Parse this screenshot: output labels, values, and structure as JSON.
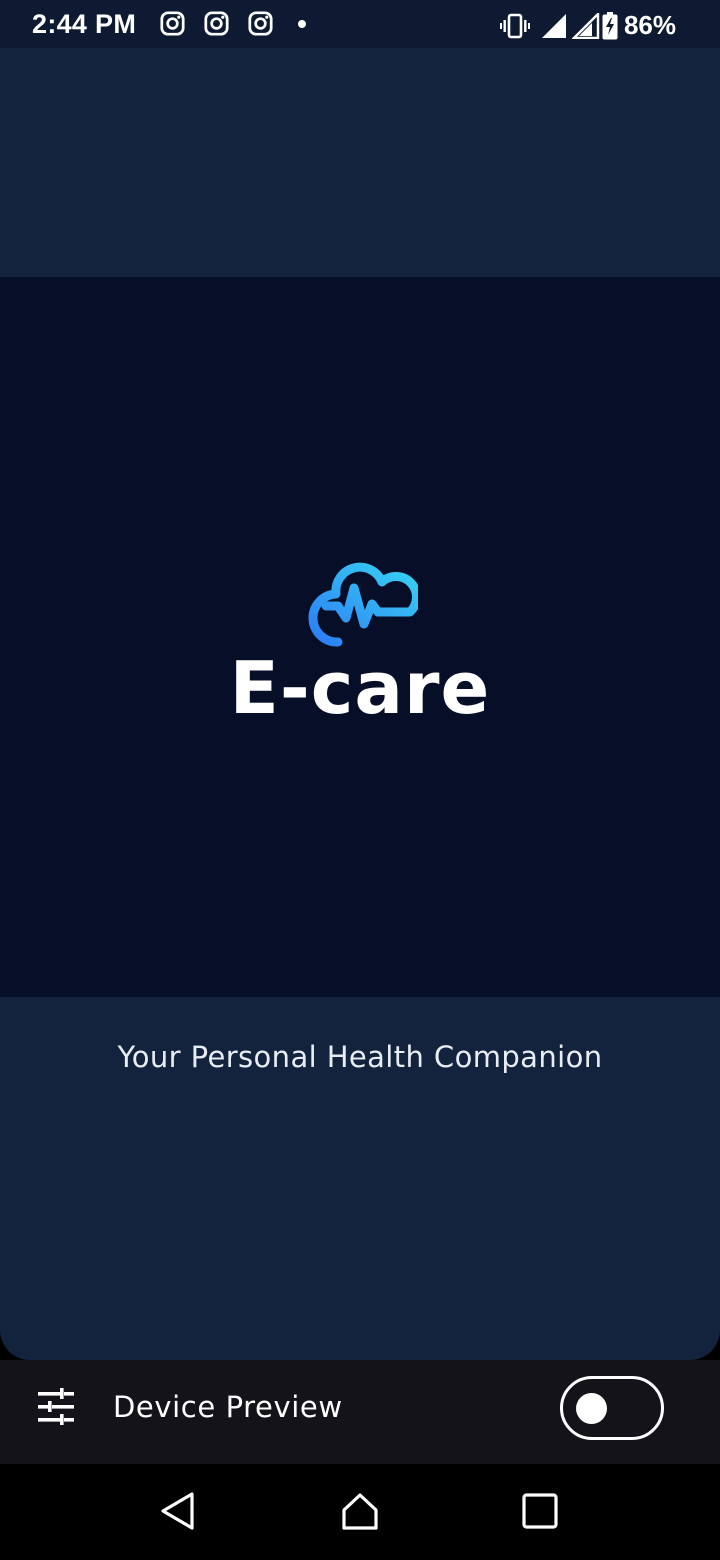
{
  "status_bar": {
    "time": "2:44 PM",
    "notification_icons": [
      "instagram-icon",
      "instagram-icon",
      "instagram-icon",
      "dot-icon"
    ],
    "system_icons": [
      "vibrate-icon",
      "signal-icon",
      "signal-icon",
      "battery-charging-icon"
    ],
    "battery": "86%"
  },
  "app": {
    "name": "E-care",
    "tagline": "Your Personal Health Companion",
    "logo_icon": "cloud-heartbeat-icon",
    "colors": {
      "background": "#13223d",
      "splash_background": "#070e27",
      "logo_gradient_start": "#2c7cf6",
      "logo_gradient_end": "#38d4f2"
    }
  },
  "device_preview": {
    "icon": "tune-icon",
    "label": "Device Preview",
    "toggle_on": false
  },
  "nav_bar": {
    "buttons": [
      "back-icon",
      "home-icon",
      "recents-icon"
    ]
  }
}
